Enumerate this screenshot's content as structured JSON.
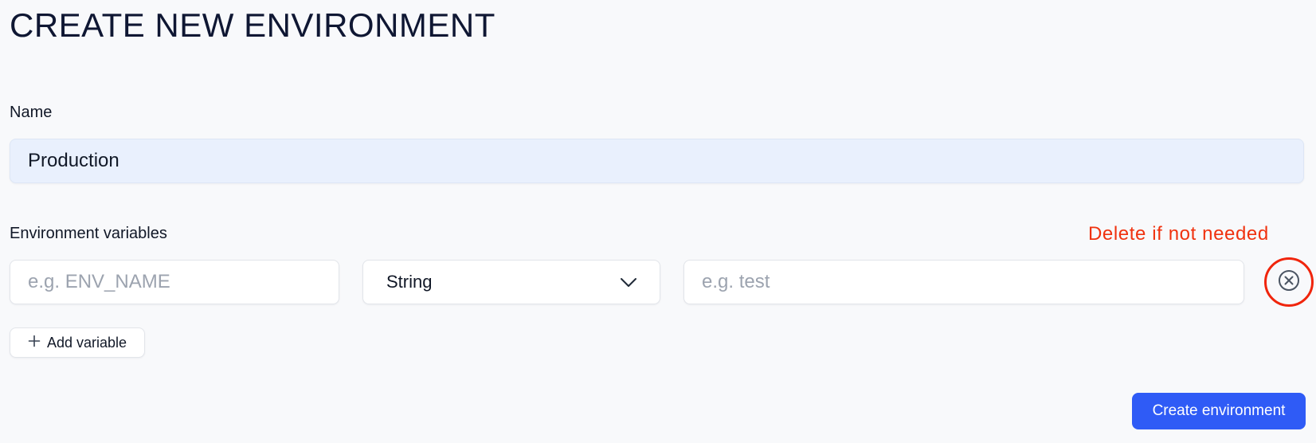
{
  "page": {
    "title": "CREATE NEW ENVIRONMENT"
  },
  "name_field": {
    "label": "Name",
    "value": "Production"
  },
  "variables": {
    "label": "Environment variables",
    "rows": [
      {
        "key_placeholder": "e.g. ENV_NAME",
        "type_value": "String",
        "value_placeholder": "e.g. test"
      }
    ],
    "add_label": "Add variable"
  },
  "annotation": {
    "text": "Delete if not needed",
    "color": "#f0320f"
  },
  "actions": {
    "create_label": "Create environment"
  },
  "colors": {
    "accent": "#2f5bf6",
    "background": "#f8f9fb",
    "name_input_bg": "#e9f0fd",
    "annotation_ring": "#f0250c"
  },
  "icons": {
    "remove": "close-circle-icon",
    "select": "chevron-down-icon",
    "add": "plus-icon"
  }
}
